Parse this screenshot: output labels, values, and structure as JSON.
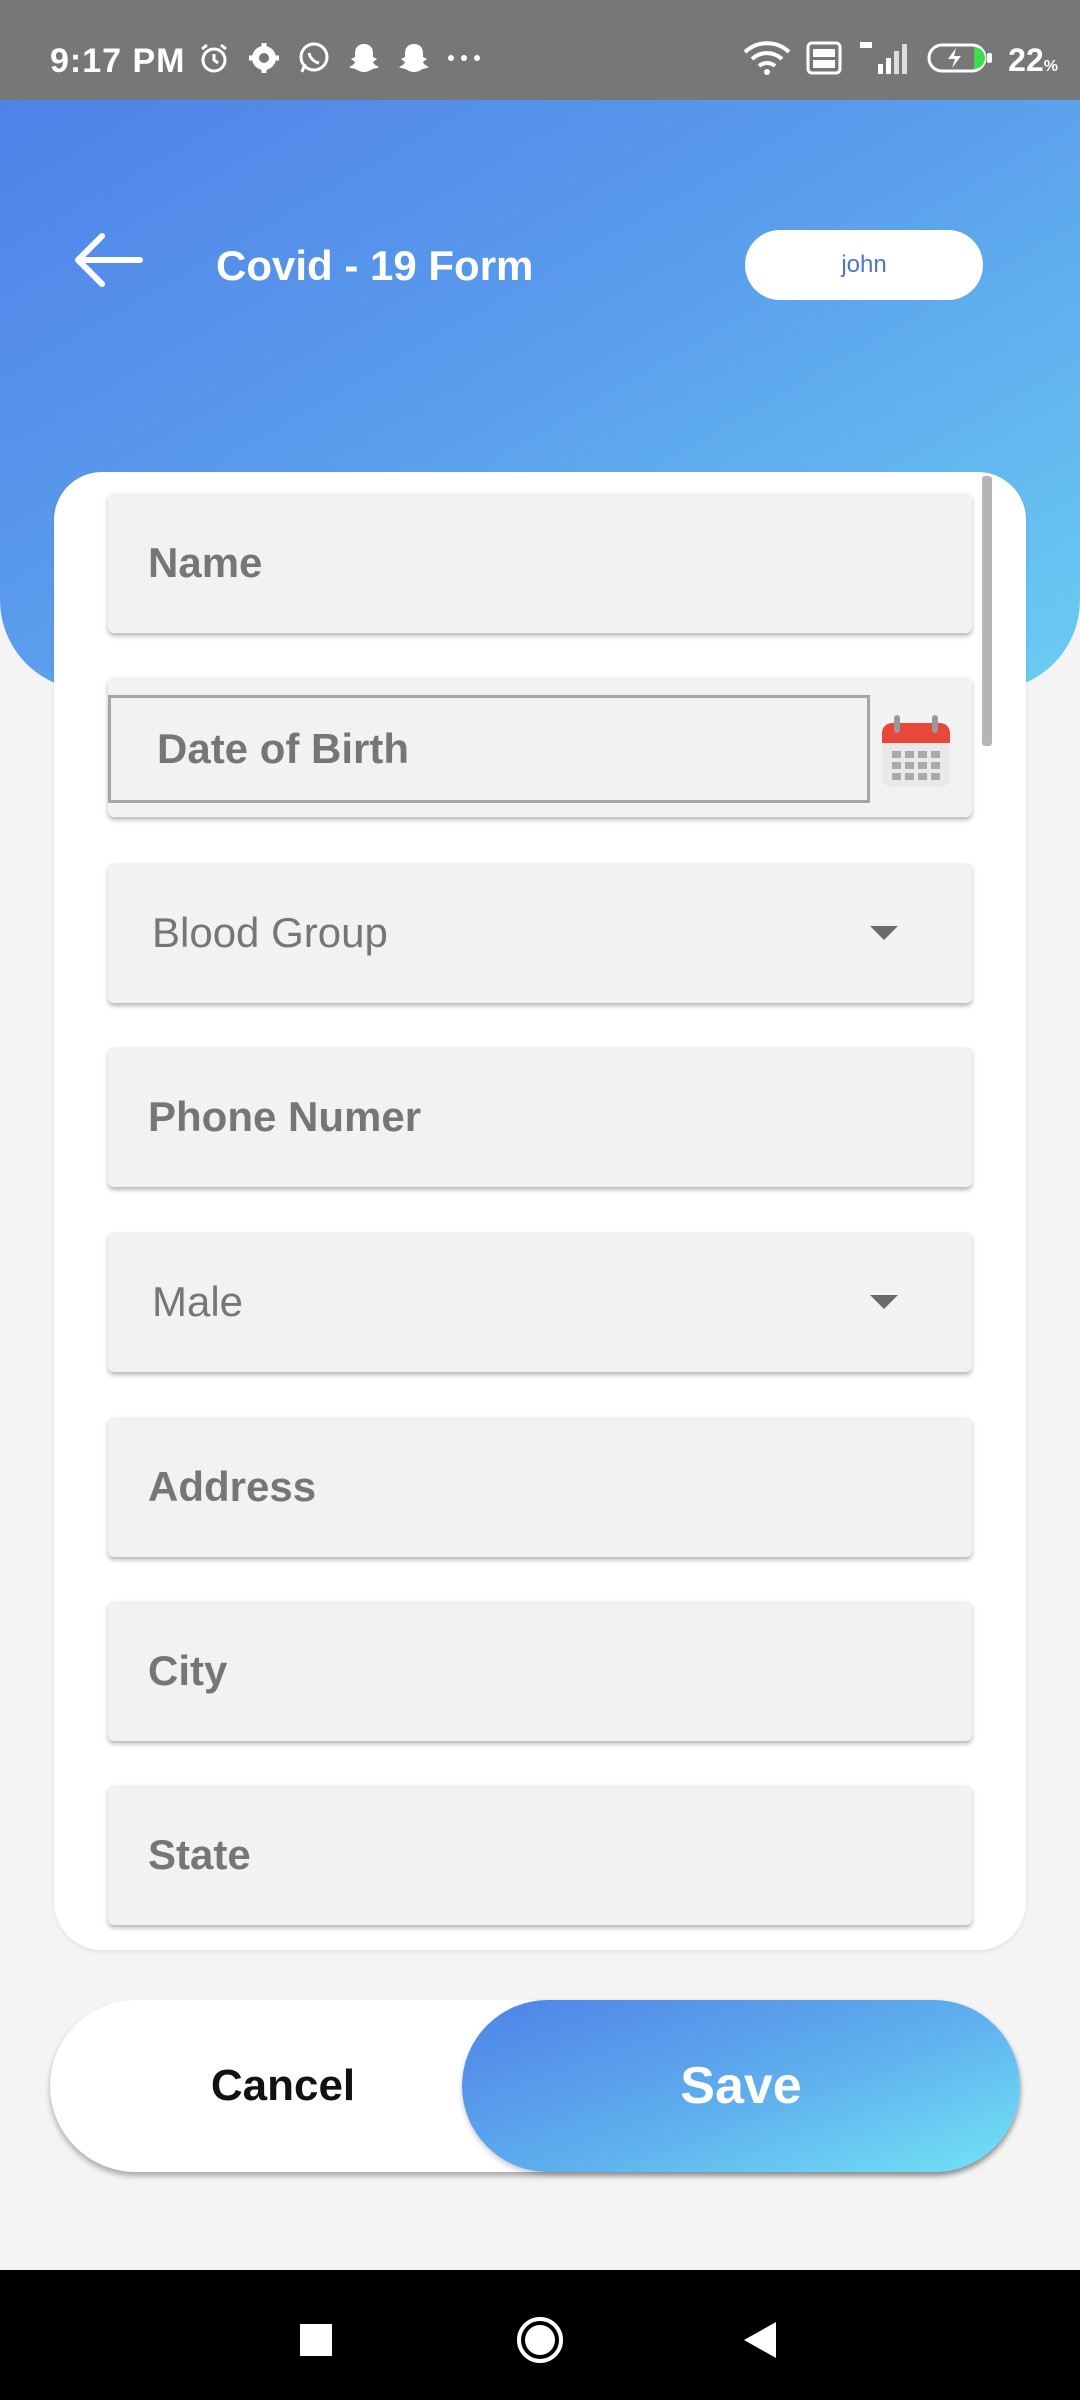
{
  "status_bar": {
    "time": "9:17 PM",
    "icons_left": [
      "alarm-icon",
      "settings-icon",
      "whatsapp-icon",
      "snapchat-icon",
      "snapchat-icon",
      "more-icon"
    ],
    "icons_right": [
      "wifi-icon",
      "volte-icon",
      "signal-4g-icon",
      "battery-charging-icon"
    ],
    "battery_percent": "22",
    "battery_unit": "%"
  },
  "header": {
    "title": "Covid - 19 Form",
    "user": "john",
    "back_icon": "arrow-left-icon"
  },
  "form": {
    "fields": [
      {
        "label": "Name",
        "type": "text"
      },
      {
        "label": "Date of Birth",
        "type": "date"
      },
      {
        "label": "Blood Group",
        "type": "dropdown"
      },
      {
        "label": "Phone Numer",
        "type": "text"
      },
      {
        "label": "Male",
        "type": "dropdown"
      },
      {
        "label": "Address",
        "type": "text"
      },
      {
        "label": "City",
        "type": "text"
      },
      {
        "label": "State",
        "type": "text"
      }
    ]
  },
  "actions": {
    "cancel": "Cancel",
    "save": "Save"
  },
  "colors": {
    "gradient_start": "#4f82e8",
    "gradient_end": "#6acdf2",
    "status_bar": "#777777",
    "field_bg": "#f2f2f2",
    "field_text": "#767676",
    "calendar_red": "#e8483c"
  }
}
